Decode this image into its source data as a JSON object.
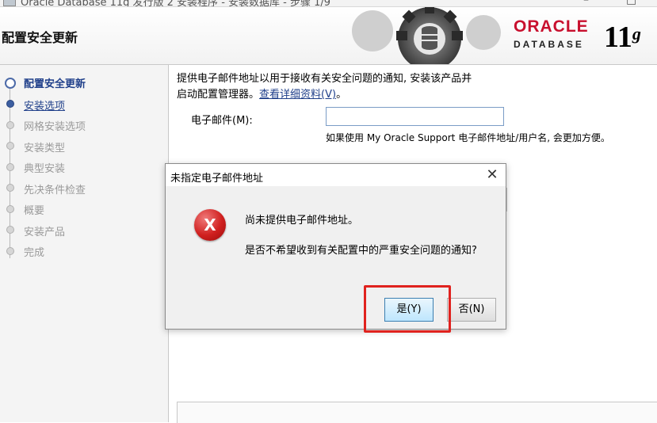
{
  "window": {
    "title": "Oracle Database 11g 发行版 2 安装程序 - 安装数据库 - 步骤 1/9",
    "controls": [
      "–",
      "□"
    ]
  },
  "header": {
    "page_title": "配置安全更新",
    "logo_oracle": "ORACLE",
    "logo_database": "DATABASE",
    "version_number": "11",
    "version_letter": "g"
  },
  "sidebar": {
    "steps": [
      {
        "label": "配置安全更新",
        "state": "current"
      },
      {
        "label": "安装选项",
        "state": "next"
      },
      {
        "label": "网格安装选项",
        "state": "disabled"
      },
      {
        "label": "安装类型",
        "state": "disabled"
      },
      {
        "label": "典型安装",
        "state": "disabled"
      },
      {
        "label": "先决条件检查",
        "state": "disabled"
      },
      {
        "label": "概要",
        "state": "disabled"
      },
      {
        "label": "安装产品",
        "state": "disabled"
      },
      {
        "label": "完成",
        "state": "disabled"
      }
    ]
  },
  "main": {
    "intro_line1": "提供电子邮件地址以用于接收有关安全问题的通知, 安装该产品并",
    "intro_line2": "启动配置管理器。",
    "details_link": "查看详细资料(V)",
    "intro_end": "。",
    "email_label": "电子邮件(M):",
    "email_value": "",
    "email_hint": "如果使用 My Oracle Support 电子邮件地址/用户名, 会更加方便。"
  },
  "dialog": {
    "title": "未指定电子邮件地址",
    "close_glyph": "✕",
    "error_glyph": "X",
    "message1": "尚未提供电子邮件地址。",
    "message2": "是否不希望收到有关配置中的严重安全问题的通知?",
    "yes_label": "是(Y)",
    "no_label": "否(N)"
  },
  "colors": {
    "oracle_red": "#c8102e",
    "highlight_red": "#e0221e",
    "link_blue": "#1f3f8a"
  }
}
